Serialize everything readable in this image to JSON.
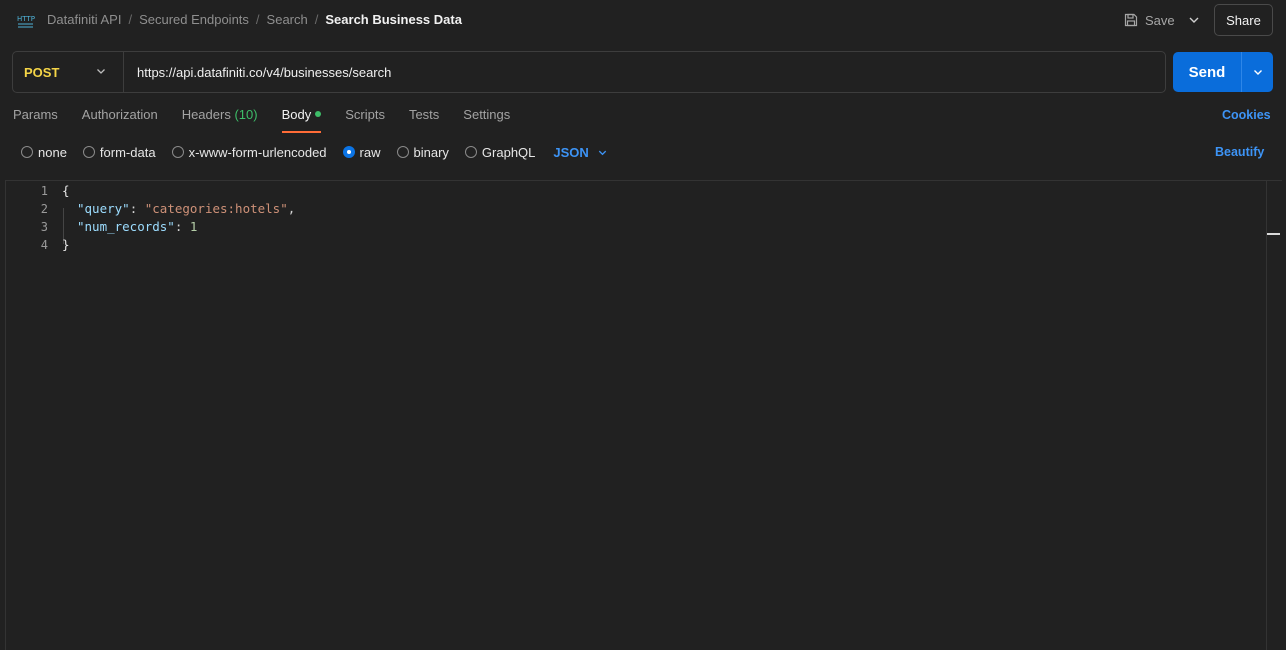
{
  "header": {
    "icon": "http-request-icon",
    "breadcrumb": [
      "Datafiniti API",
      "Secured Endpoints",
      "Search"
    ],
    "current": "Search Business Data",
    "save_label": "Save",
    "share_label": "Share"
  },
  "request": {
    "method": "POST",
    "url": "https://api.datafiniti.co/v4/businesses/search",
    "send_label": "Send"
  },
  "tabs": {
    "params": "Params",
    "authorization": "Authorization",
    "headers": "Headers",
    "headers_count": "(10)",
    "body": "Body",
    "scripts": "Scripts",
    "tests": "Tests",
    "settings": "Settings",
    "active": "Body",
    "cookies": "Cookies"
  },
  "body_types": {
    "options": [
      "none",
      "form-data",
      "x-www-form-urlencoded",
      "raw",
      "binary",
      "GraphQL"
    ],
    "selected": "raw",
    "language": "JSON",
    "beautify": "Beautify"
  },
  "editor": {
    "line_numbers": [
      "1",
      "2",
      "3",
      "4"
    ],
    "lines": {
      "l1_brace": "{",
      "l2_key": "\"query\"",
      "l2_colon": ": ",
      "l2_value": "\"categories:hotels\"",
      "l2_comma": ",",
      "l3_key": "\"num_records\"",
      "l3_colon": ": ",
      "l3_value": "1",
      "l4_brace": "}"
    }
  },
  "colors": {
    "accent_blue": "#0a6ddb",
    "method_yellow": "#f5d547",
    "active_tab_orange": "#ff6c37",
    "count_green": "#3dbd68"
  }
}
